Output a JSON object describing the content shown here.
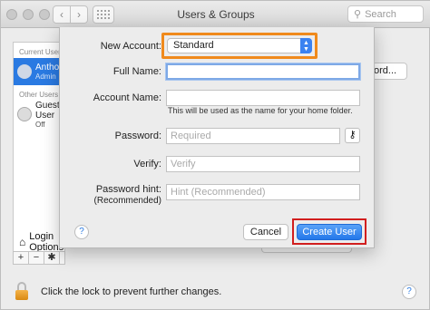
{
  "window": {
    "title": "Users & Groups",
    "search_placeholder": "Search"
  },
  "sidebar": {
    "current_header": "Current Users",
    "current_users": [
      {
        "name": "Anthony",
        "role": "Admin",
        "selected": true
      }
    ],
    "other_header": "Other Users",
    "other_users": [
      {
        "name": "Guest User",
        "status": "Off"
      }
    ],
    "login_label": "Login Options",
    "add_symbol": "+",
    "remove_symbol": "−",
    "gear_symbol": "✱"
  },
  "background": {
    "right_button_label": "ord..."
  },
  "sheet": {
    "new_account_label": "New Account:",
    "new_account_value": "Standard",
    "full_name_label": "Full Name:",
    "full_name_value": "",
    "account_name_label": "Account Name:",
    "account_name_value": "",
    "account_name_hint": "This will be used as the name for your home folder.",
    "password_label": "Password:",
    "password_placeholder": "Required",
    "verify_label": "Verify:",
    "verify_placeholder": "Verify",
    "password_hint_label": "Password hint:",
    "password_hint_sublabel": "(Recommended)",
    "password_hint_placeholder": "Hint (Recommended)",
    "help_symbol": "?",
    "cancel_label": "Cancel",
    "create_label": "Create User",
    "highlight_colors": {
      "new_account": "#f08a1c",
      "create_user": "#d11e1e"
    }
  },
  "footer": {
    "lock_text": "Click the lock to prevent further changes.",
    "help_symbol": "?"
  }
}
